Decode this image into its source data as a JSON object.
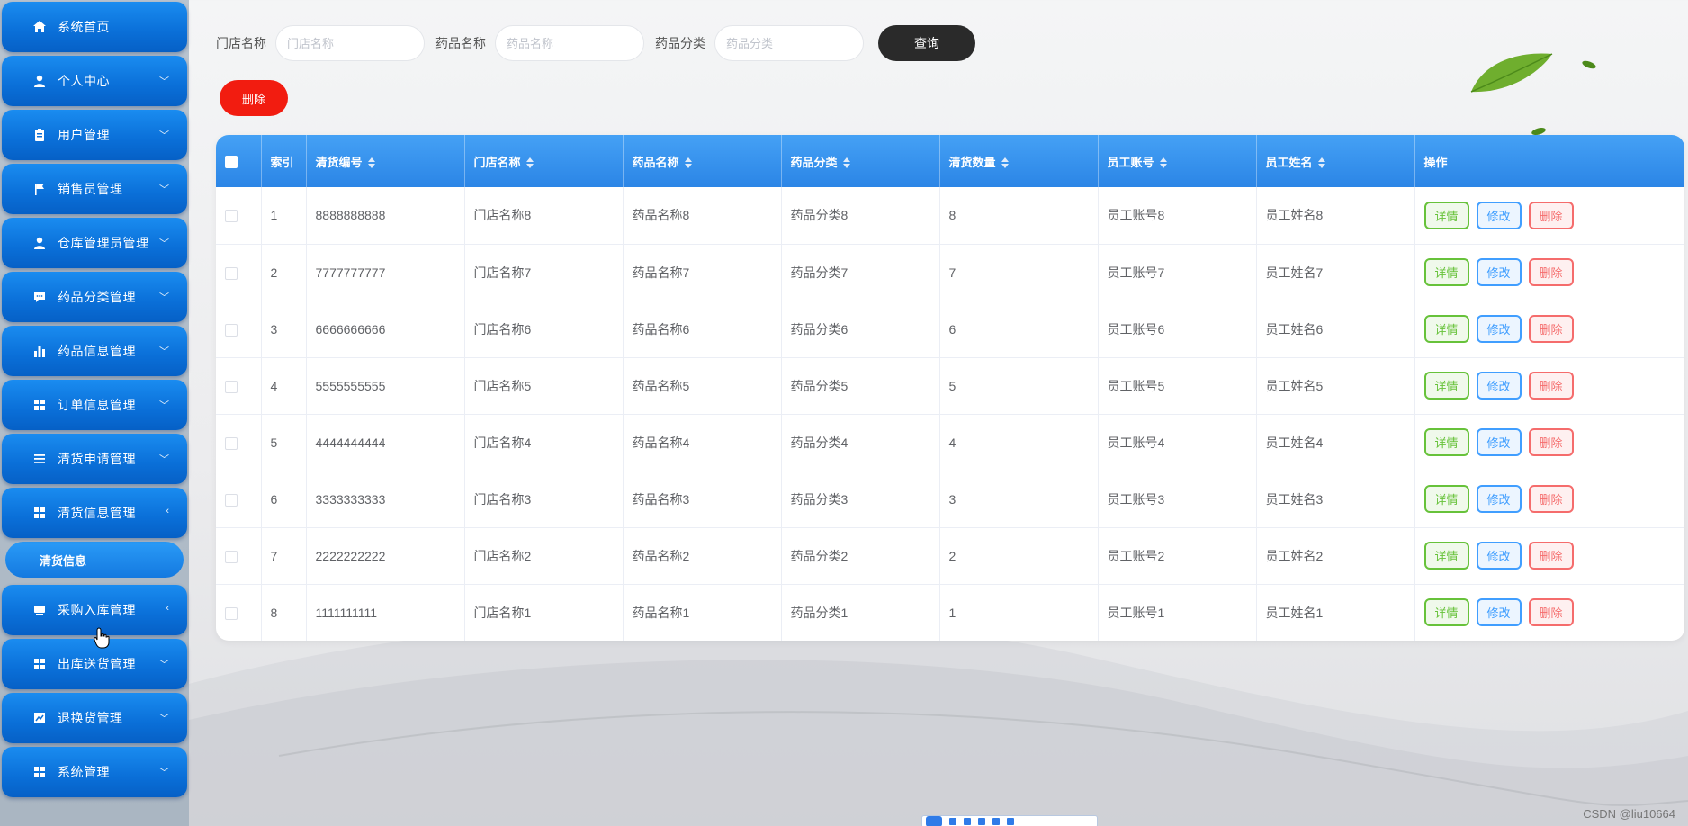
{
  "sidebar": {
    "items": [
      {
        "label": "系统首页",
        "icon": "home-icon",
        "arrow": ""
      },
      {
        "label": "个人中心",
        "icon": "user-icon",
        "arrow": "﹀"
      },
      {
        "label": "用户管理",
        "icon": "clipboard-icon",
        "arrow": "﹀"
      },
      {
        "label": "销售员管理",
        "icon": "flag-icon",
        "arrow": "﹀"
      },
      {
        "label": "仓库管理员管理",
        "icon": "user-icon",
        "arrow": "﹀"
      },
      {
        "label": "药品分类管理",
        "icon": "chat-icon",
        "arrow": "﹀"
      },
      {
        "label": "药品信息管理",
        "icon": "bar-chart-icon",
        "arrow": "﹀"
      },
      {
        "label": "订单信息管理",
        "icon": "grid-icon",
        "arrow": "﹀"
      },
      {
        "label": "清货申请管理",
        "icon": "list-icon",
        "arrow": "﹀"
      },
      {
        "label": "清货信息管理",
        "icon": "grid-icon",
        "arrow": "‹"
      }
    ],
    "active_submenu": "清货信息",
    "items_after": [
      {
        "label": "采购入库管理",
        "icon": "monitor-icon",
        "arrow": "‹"
      },
      {
        "label": "出库送货管理",
        "icon": "grid-icon",
        "arrow": "﹀"
      },
      {
        "label": "退换货管理",
        "icon": "trend-icon",
        "arrow": "﹀"
      },
      {
        "label": "系统管理",
        "icon": "grid-icon",
        "arrow": "﹀"
      }
    ]
  },
  "search": {
    "store_label": "门店名称",
    "store_placeholder": "门店名称",
    "drug_label": "药品名称",
    "drug_placeholder": "药品名称",
    "category_label": "药品分类",
    "category_placeholder": "药品分类",
    "query_button": "查询"
  },
  "toolbar": {
    "delete_button": "删除"
  },
  "table": {
    "columns": [
      "索引",
      "清货编号",
      "门店名称",
      "药品名称",
      "药品分类",
      "清货数量",
      "员工账号",
      "员工姓名",
      "操作"
    ],
    "sortable": [
      false,
      true,
      true,
      true,
      true,
      true,
      true,
      true,
      false
    ],
    "rows": [
      [
        "1",
        "8888888888",
        "门店名称8",
        "药品名称8",
        "药品分类8",
        "8",
        "员工账号8",
        "员工姓名8"
      ],
      [
        "2",
        "7777777777",
        "门店名称7",
        "药品名称7",
        "药品分类7",
        "7",
        "员工账号7",
        "员工姓名7"
      ],
      [
        "3",
        "6666666666",
        "门店名称6",
        "药品名称6",
        "药品分类6",
        "6",
        "员工账号6",
        "员工姓名6"
      ],
      [
        "4",
        "5555555555",
        "门店名称5",
        "药品名称5",
        "药品分类5",
        "5",
        "员工账号5",
        "员工姓名5"
      ],
      [
        "5",
        "4444444444",
        "门店名称4",
        "药品名称4",
        "药品分类4",
        "4",
        "员工账号4",
        "员工姓名4"
      ],
      [
        "6",
        "3333333333",
        "门店名称3",
        "药品名称3",
        "药品分类3",
        "3",
        "员工账号3",
        "员工姓名3"
      ],
      [
        "7",
        "2222222222",
        "门店名称2",
        "药品名称2",
        "药品分类2",
        "2",
        "员工账号2",
        "员工姓名2"
      ],
      [
        "8",
        "1111111111",
        "门店名称1",
        "药品名称1",
        "药品分类1",
        "1",
        "员工账号1",
        "员工姓名1"
      ]
    ],
    "ops": {
      "detail": "详情",
      "edit": "修改",
      "delete": "删除"
    }
  },
  "watermark": "CSDN @liu10664",
  "colors": {
    "sidebar_button": "#0a6fd8",
    "table_header": "#2b85e6",
    "query_button": "#2a2a2a",
    "delete_button": "#f21c10",
    "op_detail": "#67c23a",
    "op_edit": "#409eff",
    "op_delete": "#f56c6c"
  }
}
